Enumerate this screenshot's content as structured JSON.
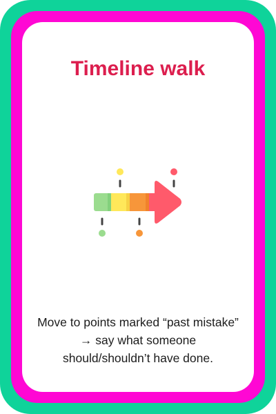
{
  "card": {
    "title": "Timeline walk",
    "caption": "Move to points marked “past mistake” → say what someone should/shouldn’t have done.",
    "illustration_icon": "timeline-arrow-icon"
  },
  "colors": {
    "outer_border": "#0fd39a",
    "inner_border": "#ff07d4",
    "background": "#ffffff",
    "title": "#dc1e4e",
    "caption": "#1c1c1c",
    "arrow_green": "#9bdc8f",
    "arrow_yellow": "#ffe85a",
    "arrow_orange": "#f7963a",
    "arrow_red": "#ff5a6b",
    "tick": "#444444"
  }
}
